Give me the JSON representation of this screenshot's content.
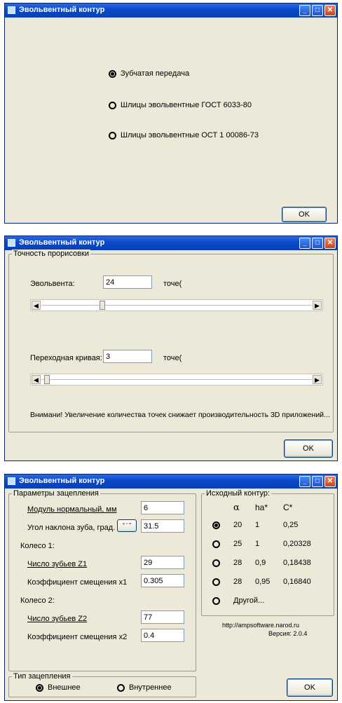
{
  "window_title": "Эвольвентный контур",
  "window1": {
    "options": [
      "Зубчатая передача",
      "Шлицы эвольвентные ГОСТ 6033-80",
      "Шлицы эвольвентные ОСТ 1 00086-73"
    ],
    "selected_index": 0,
    "ok_label": "OK"
  },
  "window2": {
    "group_label": "Точность прорисовки",
    "involute_label": "Эвольвента:",
    "involute_value": "24",
    "involute_unit": "точе(",
    "involute_slider_fraction": 0.22,
    "transition_label": "Переходная кривая:",
    "transition_value": "3",
    "transition_unit": "точе(",
    "transition_slider_fraction": 0.01,
    "warning": "Внимани! Увеличение количества точек снижает производительность 3D приложений...",
    "ok_label": "OK"
  },
  "window3": {
    "params_group": "Параметры зацепления",
    "module_label": "Модуль нормальный, мм",
    "module_value": "6",
    "angle_label": "Угол наклона зуба, град.",
    "angle_button": "° ' \"",
    "angle_value": "31.5",
    "wheel1_label": "Колесо 1:",
    "z1_label": "Число зубьев Z1",
    "z1_value": "29",
    "x1_label": "Коэффициент смещения x1",
    "x1_value": "0.305",
    "wheel2_label": "Колесо 2:",
    "z2_label": "Число зубьев Z2",
    "z2_value": "77",
    "x2_label": "Коэффициент смещения x2",
    "x2_value": "0.4",
    "source_group": "Исходный контур:",
    "source_headers": [
      "α",
      "ha*",
      "C*"
    ],
    "source_rows": [
      {
        "alpha": "20",
        "ha": "1",
        "c": "0,25"
      },
      {
        "alpha": "25",
        "ha": "1",
        "c": "0,20328"
      },
      {
        "alpha": "28",
        "ha": "0,9",
        "c": "0,18438"
      },
      {
        "alpha": "28",
        "ha": "0,95",
        "c": "0,16840"
      }
    ],
    "other_label": "Другой...",
    "source_selected_index": 0,
    "url": "http://ampsoftware.narod.ru",
    "version": "Версия: 2.0.4",
    "mesh_group": "Тип зацепления",
    "mesh_options": [
      "Внешнее",
      "Внутреннее"
    ],
    "mesh_selected_index": 0,
    "ok_label": "OK"
  }
}
